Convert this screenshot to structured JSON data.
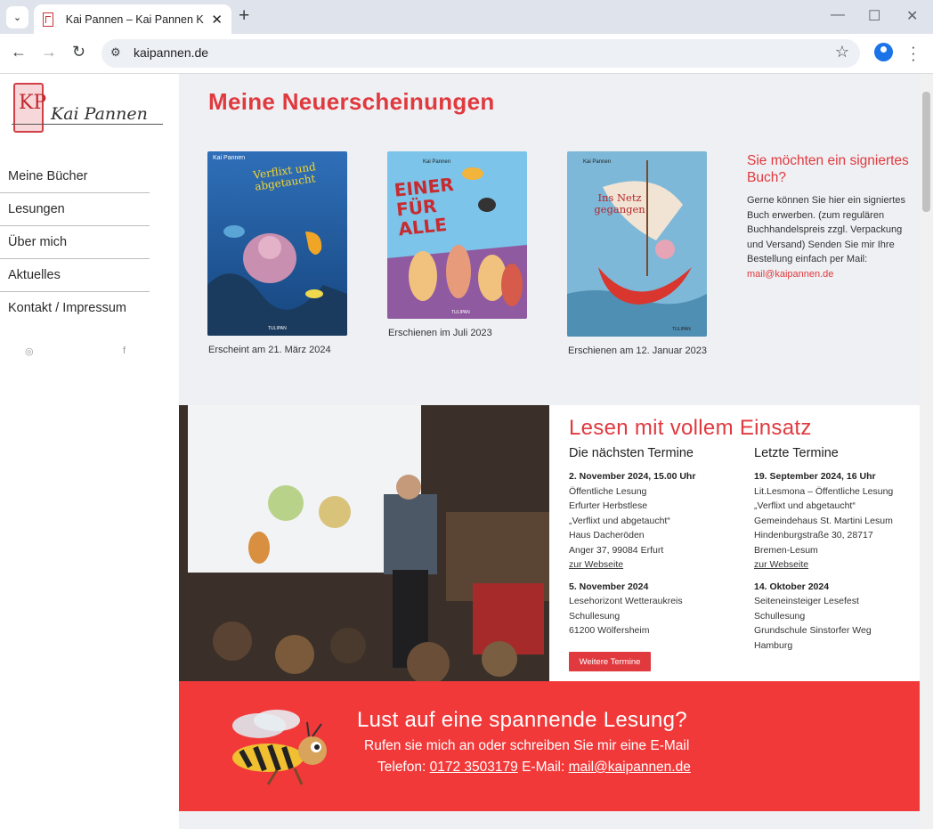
{
  "browser": {
    "tab_title": "Kai Pannen – Kai Pannen Kinder",
    "url": "kaipannen.de"
  },
  "sidebar": {
    "logo_name": "Kai Pannen",
    "logo_mark": "KP",
    "items": [
      {
        "label": "Meine Bücher"
      },
      {
        "label": "Lesungen"
      },
      {
        "label": "Über mich"
      },
      {
        "label": "Aktuelles"
      },
      {
        "label": "Kontakt / Impressum"
      }
    ]
  },
  "new_releases": {
    "heading": "Meine Neuerscheinungen",
    "books": [
      {
        "cover_author": "Kai Pannen",
        "cover_title": "Verflixt und abgetaucht",
        "caption": "Erscheint am 21. März 2024"
      },
      {
        "cover_author": "Kai Pannen",
        "cover_title": "EINER FÜR ALLE",
        "caption": "Erschienen im Juli 2023"
      },
      {
        "cover_author": "Kai Pannen",
        "cover_title": "Ins Netz gegangen",
        "caption": "Erschienen am 12. Januar 2023"
      }
    ],
    "publisher": "TULIPAN"
  },
  "signed_book": {
    "heading": "Sie möchten ein signiertes Buch?",
    "text": "Gerne können Sie hier ein signiertes Buch erwerben. (zum regulären Buchhandelspreis zzgl. Verpackung und Versand) Senden Sie mir Ihre Bestellung einfach per Mail:",
    "mail": "mail@kaipannen.de"
  },
  "events": {
    "heading": "Lesen mit vollem Einsatz",
    "next_heading": "Die nächsten Termine",
    "last_heading": "Letzte Termine",
    "next": [
      {
        "date": "2. November 2024, 15.00 Uhr",
        "lines": [
          "Öffentliche Lesung",
          "Erfurter Herbstlese",
          "„Verflixt und abgetaucht“",
          "Haus Dacheröden",
          "Anger 37, 99084 Erfurt"
        ],
        "link": "zur Webseite"
      },
      {
        "date": "5. November 2024",
        "lines": [
          "Lesehorizont Wetteraukreis",
          "Schullesung",
          "61200 Wölfersheim"
        ]
      }
    ],
    "last": [
      {
        "date": "19. September 2024, 16 Uhr",
        "lines": [
          "Lit.Lesmona – Öffentliche Lesung",
          "„Verflixt und abgetaucht“",
          "Gemeindehaus St. Martini Lesum",
          "Hindenburgstraße 30, 28717",
          "Bremen-Lesum"
        ],
        "link": "zur Webseite"
      },
      {
        "date": "14. Oktober 2024",
        "lines": [
          "Seiteneinsteiger Lesefest",
          "Schullesung",
          "Grundschule Sinstorfer Weg",
          "Hamburg"
        ]
      }
    ],
    "button": "Weitere Termine"
  },
  "cta": {
    "heading": "Lust auf eine spannende Lesung?",
    "sub": "Rufen sie mich an oder schreiben Sie mir eine E-Mail",
    "phone_label": "Telefon:",
    "phone": "0172 3503179",
    "mail_label": "E-Mail:",
    "mail": "mail@kaipannen.de"
  },
  "colors": {
    "accent": "#e0393e",
    "cta": "#f2393a",
    "background": "#eef0f3"
  }
}
